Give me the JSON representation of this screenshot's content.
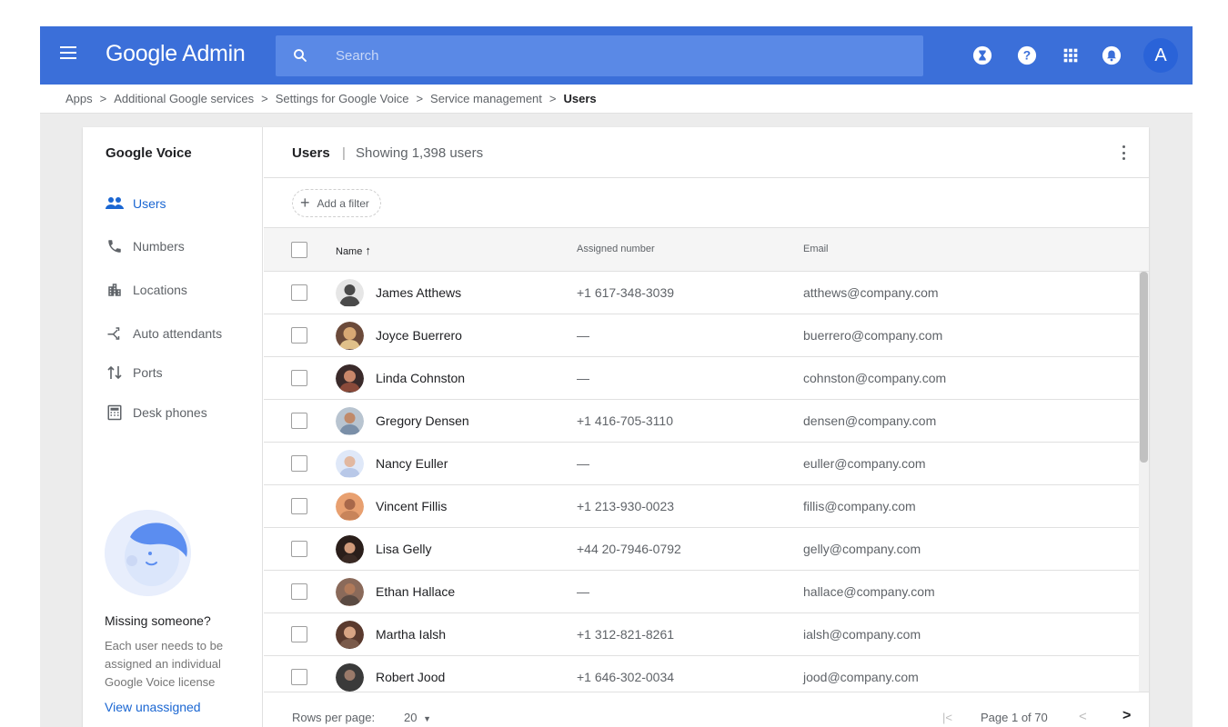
{
  "app": {
    "brand": "Google Admin",
    "menu_icon": "hamburger-menu-icon",
    "search": {
      "placeholder": "Search",
      "icon": "search-icon"
    },
    "top_icons": [
      "hourglass-icon",
      "help-icon",
      "apps-grid-icon",
      "notifications-icon"
    ],
    "account_initial": "A",
    "colors": {
      "topbar": "#3b6fd9",
      "accent": "#1a66d2",
      "search_bg": "#5a89e6"
    }
  },
  "breadcrumb": {
    "items": [
      "Apps",
      "Additional Google services",
      "Settings for Google Voice",
      "Service management"
    ],
    "separator": ">",
    "current": "Users"
  },
  "sidebar": {
    "title": "Google Voice",
    "items": [
      {
        "label": "Users",
        "icon": "people-icon",
        "active": true
      },
      {
        "label": "Numbers",
        "icon": "phone-icon",
        "active": false
      },
      {
        "label": "Locations",
        "icon": "building-icon",
        "active": false
      },
      {
        "label": "Auto attendants",
        "icon": "call-split-icon",
        "active": false
      },
      {
        "label": "Ports",
        "icon": "port-arrows-icon",
        "active": false
      },
      {
        "label": "Desk phones",
        "icon": "desk-phone-icon",
        "active": false
      }
    ],
    "missing": {
      "title": "Missing someone?",
      "description": "Each user needs to be assigned an individual Google Voice license",
      "link": "View unassigned"
    }
  },
  "main": {
    "title": "Users",
    "separator": "|",
    "count_text": "Showing 1,398 users",
    "filter_label": "Add a filter",
    "columns": {
      "name": "Name",
      "name_sort": "↑",
      "number": "Assigned number",
      "email": "Email"
    },
    "rows": [
      {
        "name": "James Atthews",
        "number": "+1 617-348-3039",
        "email": "atthews@company.com",
        "avatar_color": "#4a4a4a"
      },
      {
        "name": "Joyce Buerrero",
        "number": "—",
        "email": "buerrero@company.com",
        "avatar_color": "#d8a874"
      },
      {
        "name": "Linda Cohnston",
        "number": "—",
        "email": "cohnston@company.com",
        "avatar_color": "#8a4a3a"
      },
      {
        "name": "Gregory Densen",
        "number": "+1 416-705-3110",
        "email": "densen@company.com",
        "avatar_color": "#7a8fa8"
      },
      {
        "name": "Nancy Euller",
        "number": "—",
        "email": "euller@company.com",
        "avatar_color": "#b8c8e8"
      },
      {
        "name": "Vincent Fillis",
        "number": "+1 213-930-0023",
        "email": "fillis@company.com",
        "avatar_color": "#c8845a"
      },
      {
        "name": "Lisa Gelly",
        "number": "+44 20-7946-0792",
        "email": "gelly@company.com",
        "avatar_color": "#2a1e1a"
      },
      {
        "name": "Ethan Hallace",
        "number": "—",
        "email": "hallace@company.com",
        "avatar_color": "#5a4a42"
      },
      {
        "name": "Martha Ialsh",
        "number": "+1 312-821-8261",
        "email": "ialsh@company.com",
        "avatar_color": "#7a5a4a"
      },
      {
        "name": "Robert Jood",
        "number": "+1 646-302-0034",
        "email": "jood@company.com",
        "avatar_color": "#3a3a3a"
      }
    ]
  },
  "pagination": {
    "rows_label": "Rows per page:",
    "rows_value": "20",
    "first_icon": "|<",
    "page_text": "Page 1 of 70",
    "prev_icon": "<",
    "next_icon": ">"
  }
}
